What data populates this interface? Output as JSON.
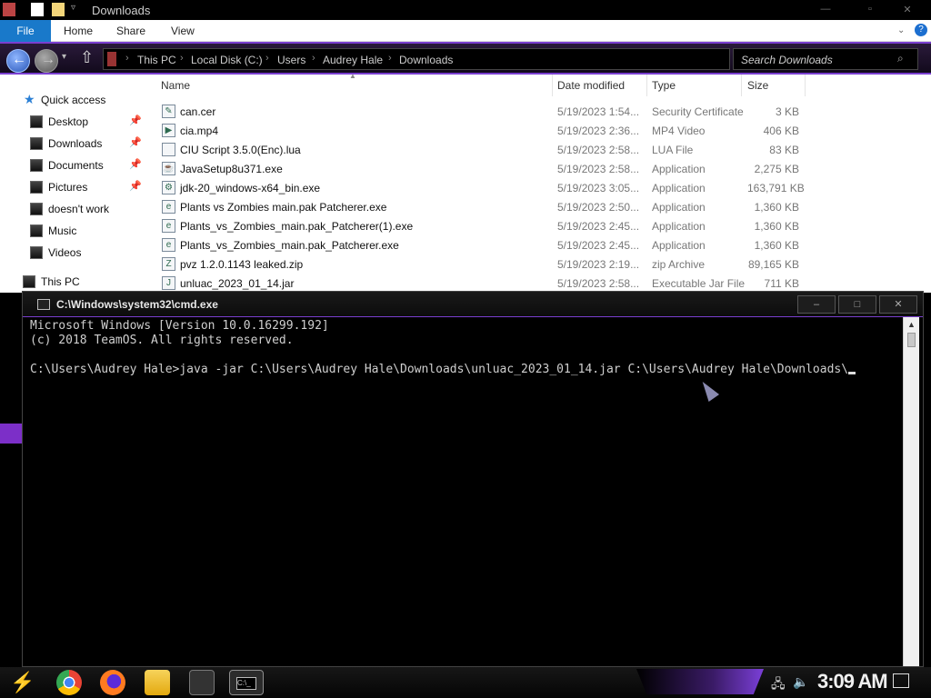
{
  "window": {
    "title": "Downloads"
  },
  "ribbon": {
    "tabs": [
      "File",
      "Home",
      "Share",
      "View"
    ]
  },
  "address": {
    "breadcrumbs": [
      "This PC",
      "Local Disk (C:)",
      "Users",
      "Audrey Hale",
      "Downloads"
    ],
    "search_placeholder": "Search Downloads"
  },
  "nav": {
    "quick_access": "Quick access",
    "items": [
      {
        "label": "Desktop",
        "pinned": true
      },
      {
        "label": "Downloads",
        "pinned": true
      },
      {
        "label": "Documents",
        "pinned": true
      },
      {
        "label": "Pictures",
        "pinned": true
      },
      {
        "label": "doesn't work",
        "pinned": false
      },
      {
        "label": "Music",
        "pinned": false
      },
      {
        "label": "Videos",
        "pinned": false
      }
    ],
    "this_pc": "This PC"
  },
  "columns": [
    "Name",
    "Date modified",
    "Type",
    "Size"
  ],
  "files": [
    {
      "name": "can.cer",
      "date": "5/19/2023 1:54...",
      "type": "Security Certificate",
      "size": "3 KB",
      "icon": "certificate-icon"
    },
    {
      "name": "cia.mp4",
      "date": "5/19/2023 2:36...",
      "type": "MP4 Video",
      "size": "406 KB",
      "icon": "video-icon"
    },
    {
      "name": "CIU Script 3.5.0(Enc).lua",
      "date": "5/19/2023 2:58...",
      "type": "LUA File",
      "size": "83 KB",
      "icon": "file-icon"
    },
    {
      "name": "JavaSetup8u371.exe",
      "date": "5/19/2023 2:58...",
      "type": "Application",
      "size": "2,275 KB",
      "icon": "java-icon"
    },
    {
      "name": "jdk-20_windows-x64_bin.exe",
      "date": "5/19/2023 3:05...",
      "type": "Application",
      "size": "163,791 KB",
      "icon": "installer-icon"
    },
    {
      "name": "Plants vs Zombies main.pak Patcherer.exe",
      "date": "5/19/2023 2:50...",
      "type": "Application",
      "size": "1,360 KB",
      "icon": "edge-icon"
    },
    {
      "name": "Plants_vs_Zombies_main.pak_Patcherer(1).exe",
      "date": "5/19/2023 2:45...",
      "type": "Application",
      "size": "1,360 KB",
      "icon": "edge-icon"
    },
    {
      "name": "Plants_vs_Zombies_main.pak_Patcherer.exe",
      "date": "5/19/2023 2:45...",
      "type": "Application",
      "size": "1,360 KB",
      "icon": "edge-icon"
    },
    {
      "name": "pvz 1.2.0.1143 leaked.zip",
      "date": "5/19/2023 2:19...",
      "type": "zip Archive",
      "size": "89,165 KB",
      "icon": "zip-icon"
    },
    {
      "name": "unluac_2023_01_14.jar",
      "date": "5/19/2023 2:58...",
      "type": "Executable Jar File",
      "size": "711 KB",
      "icon": "jar-icon"
    }
  ],
  "cmd": {
    "title": "C:\\Windows\\system32\\cmd.exe",
    "lines": [
      "Microsoft Windows [Version 10.0.16299.192]",
      "(c) 2018 TeamOS. All rights reserved.",
      "",
      "C:\\Users\\Audrey Hale>java -jar C:\\Users\\Audrey Hale\\Downloads\\unluac_2023_01_14.jar C:\\Users\\Audrey Hale\\Downloads\\"
    ]
  },
  "taskbar": {
    "apps": [
      "chrome-icon",
      "firefox-icon",
      "file-explorer-icon",
      "task-manager-icon",
      "cmd-icon"
    ],
    "clock": "3:09 AM"
  },
  "colors": {
    "accent": "#7a3fd0",
    "file_tab": "#1979ca",
    "clock": "#f0f0f0"
  }
}
